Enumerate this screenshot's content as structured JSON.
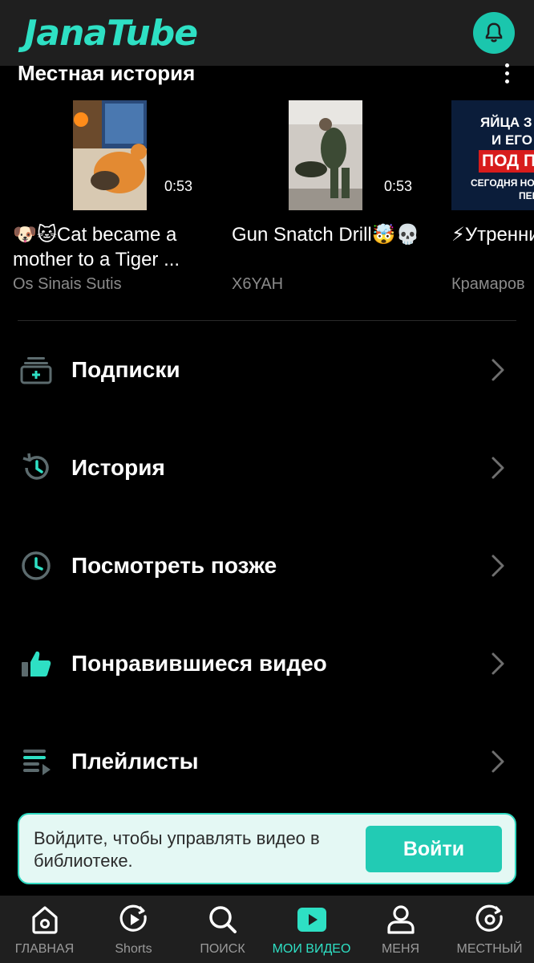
{
  "header": {
    "logo": "JanaTube",
    "bell_icon": "bell-icon",
    "accent": "#2ee0c4"
  },
  "section": {
    "title": "Местная история",
    "more_icon": "more-vertical-icon"
  },
  "videos": [
    {
      "title": "🐶🐱Cat became a mother to a Tiger ...",
      "channel": "Os Sinais Sutis",
      "duration": "0:53"
    },
    {
      "title": "Gun Snatch Drill🤯💀",
      "channel": "X6YAH",
      "duration": "0:53"
    },
    {
      "title": "⚡Утренний выпуск н",
      "channel": "Крамаров",
      "duration": "",
      "thumb_text": [
        "ЯЙЦА З",
        "И ЕГО",
        "ПОД П",
        "СЕГОДНЯ НОЧ",
        "ПЕР"
      ]
    }
  ],
  "menu": [
    {
      "label": "Подписки",
      "icon": "subscriptions-icon"
    },
    {
      "label": "История",
      "icon": "history-icon"
    },
    {
      "label": "Посмотреть позже",
      "icon": "clock-icon"
    },
    {
      "label": "Понравившиеся видео",
      "icon": "thumbs-up-icon"
    },
    {
      "label": "Плейлисты",
      "icon": "playlist-icon"
    }
  ],
  "login": {
    "text": "Войдите, чтобы управлять видео в библиотеке.",
    "button": "Войти"
  },
  "nav": [
    {
      "label": "ГЛАВНАЯ",
      "icon": "home-icon",
      "active": false
    },
    {
      "label": "Shorts",
      "icon": "shorts-icon",
      "active": false
    },
    {
      "label": "ПОИСК",
      "icon": "search-icon",
      "active": false
    },
    {
      "label": "МОИ ВИДЕО",
      "icon": "library-play-icon",
      "active": true
    },
    {
      "label": "МЕНЯ",
      "icon": "profile-icon",
      "active": false
    },
    {
      "label": "МЕСТНЫЙ",
      "icon": "local-icon",
      "active": false
    }
  ]
}
